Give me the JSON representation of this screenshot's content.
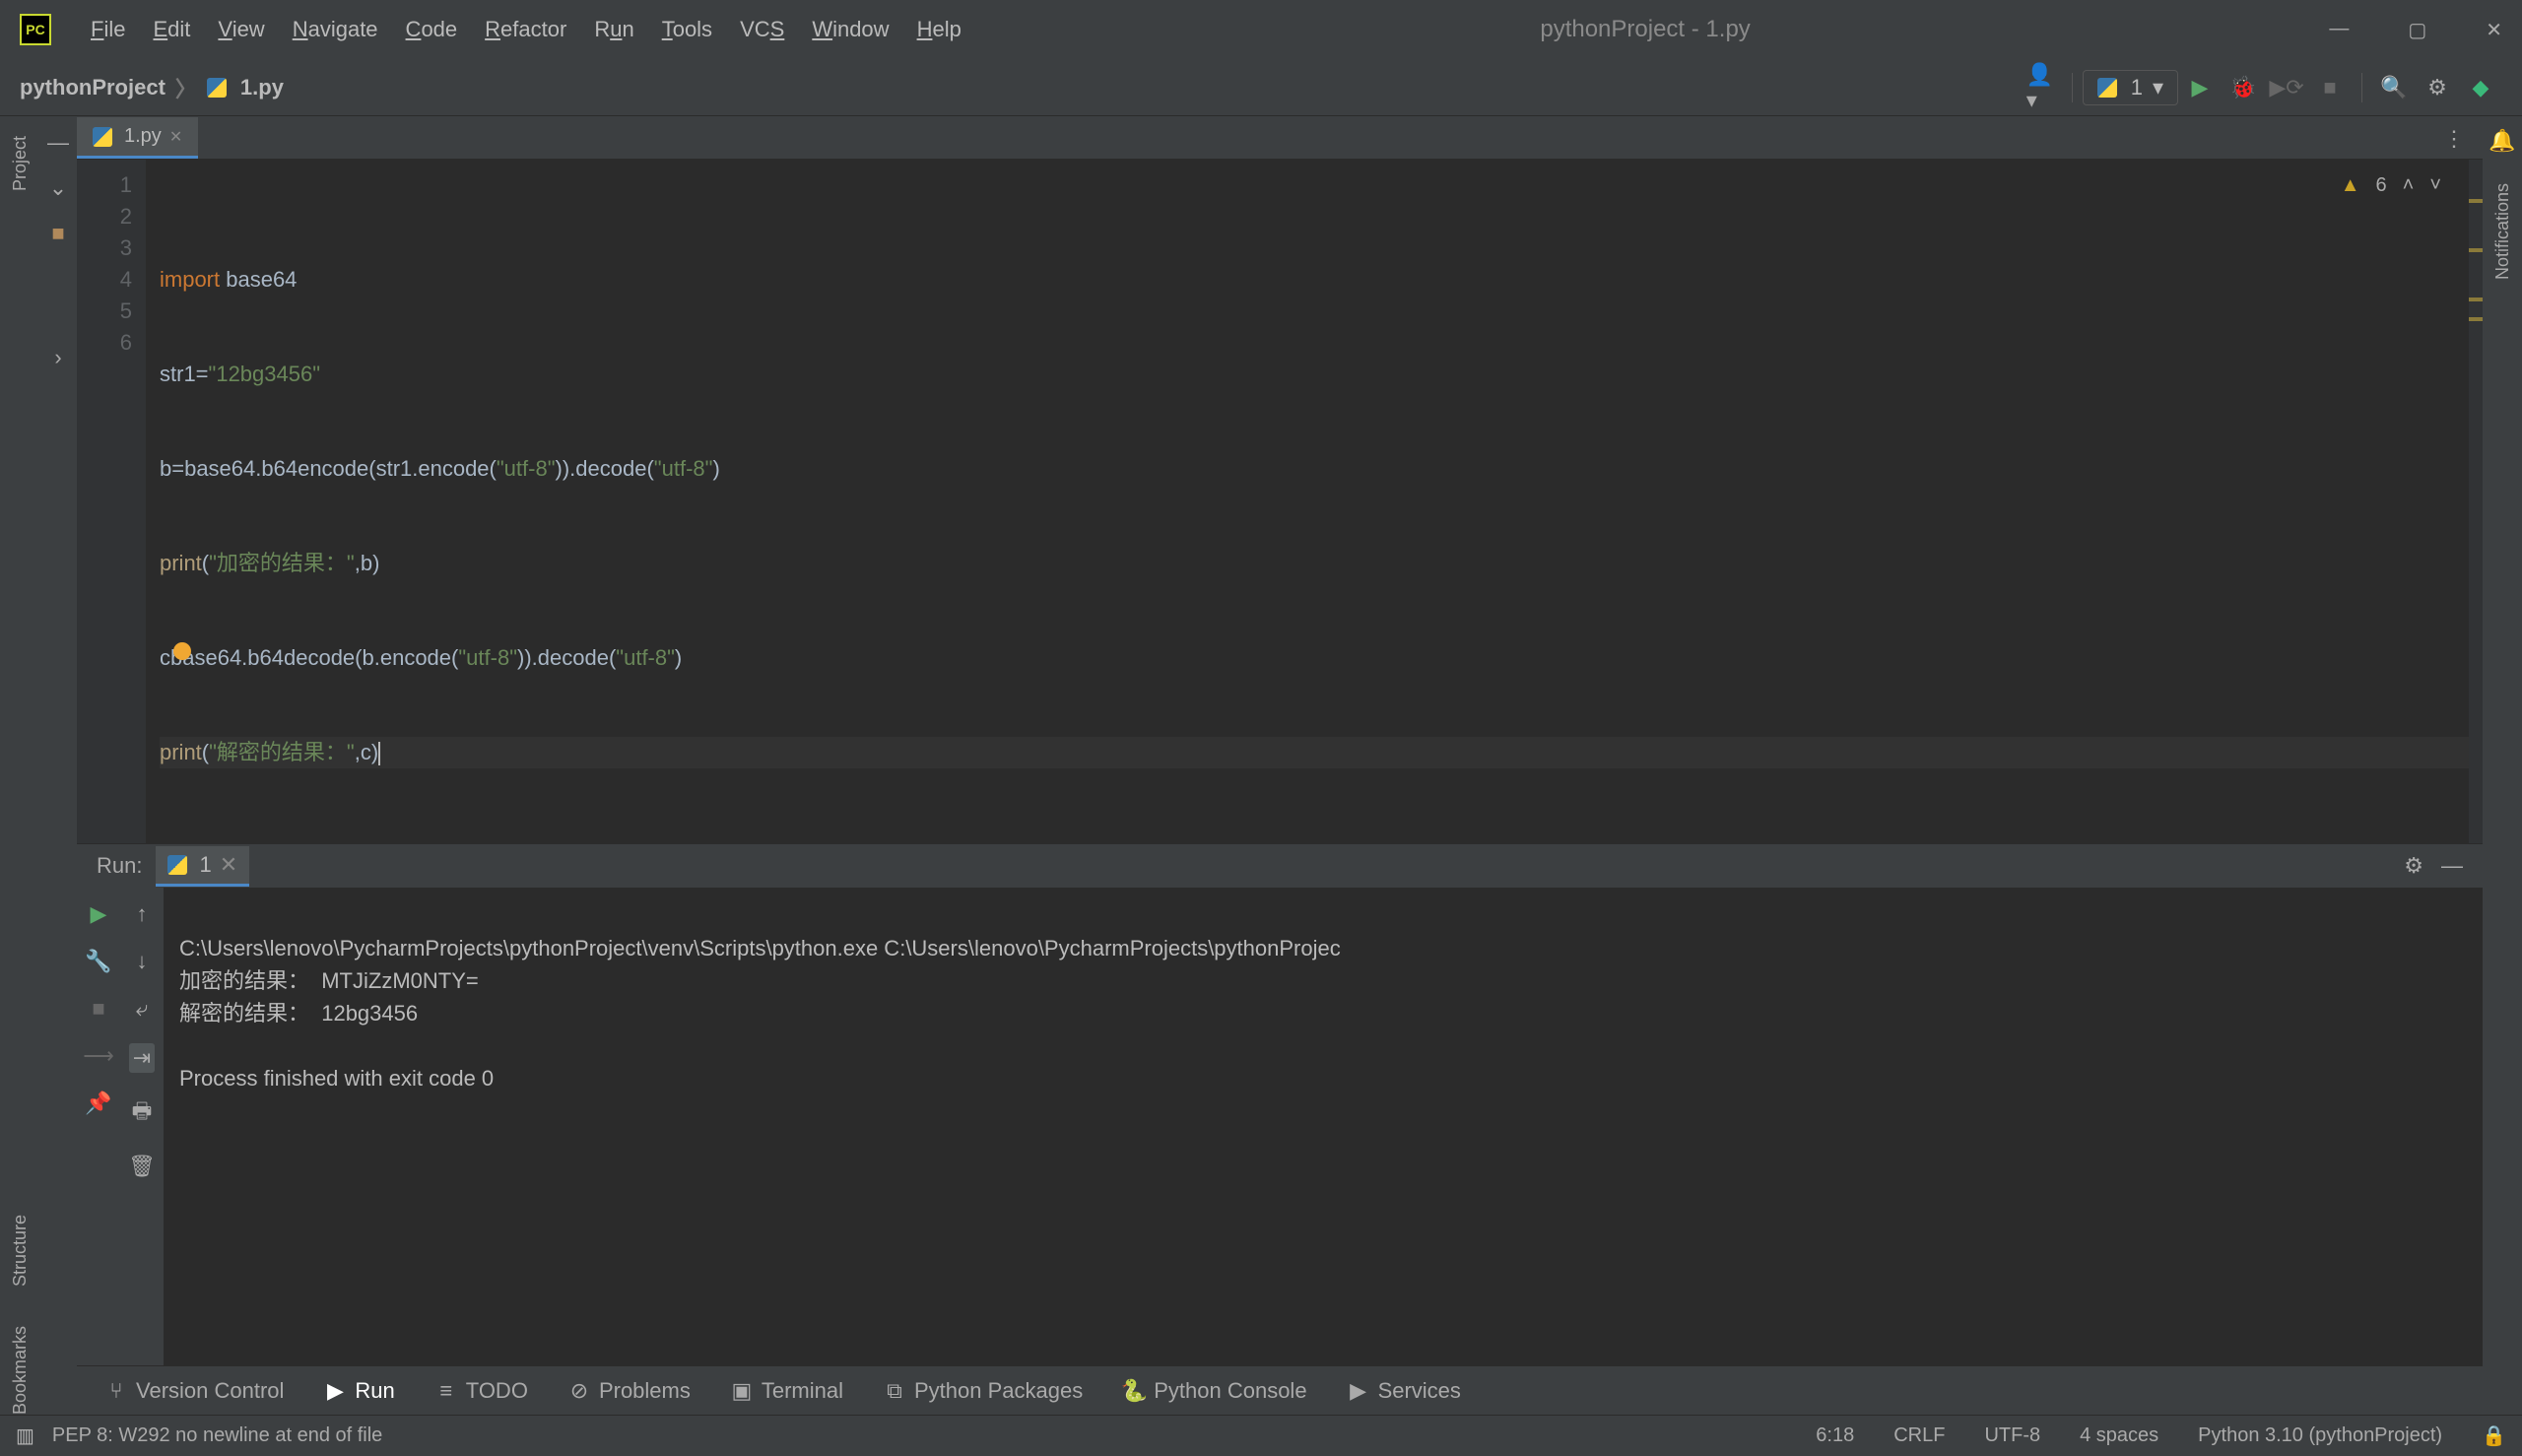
{
  "window": {
    "title": "pythonProject - 1.py"
  },
  "menu": {
    "file": "File",
    "edit": "Edit",
    "view": "View",
    "navigate": "Navigate",
    "code": "Code",
    "refactor": "Refactor",
    "run": "Run",
    "tools": "Tools",
    "vcs": "VCS",
    "window": "Window",
    "help": "Help"
  },
  "breadcrumb": {
    "project": "pythonProject",
    "file": "1.py"
  },
  "runConfig": {
    "name": "1"
  },
  "leftTools": {
    "project": "Project",
    "structure": "Structure",
    "bookmarks": "Bookmarks"
  },
  "rightTools": {
    "notifications": "Notifications"
  },
  "tab": {
    "name": "1.py"
  },
  "inspection": {
    "warnings": "6"
  },
  "code": {
    "lines": [
      "1",
      "2",
      "3",
      "4",
      "5",
      "6"
    ],
    "l1_kw": "import",
    "l1_id": " base64",
    "l2_a": "str1=",
    "l2_s": "\"12bg3456\"",
    "l3_a": "b=base64.b64encode(str1.encode(",
    "l3_s1": "\"utf-8\"",
    "l3_b": ")).decode(",
    "l3_s2": "\"utf-8\"",
    "l3_c": ")",
    "l4_fn": "print",
    "l4_a": "(",
    "l4_s": "\"加密的结果：\"",
    "l4_b": ",b)",
    "l5_a": "c=base64.b64decode(b.encode(",
    "l5_s1": "\"utf-8\"",
    "l5_b": ")).decode(",
    "l5_s2": "\"utf-8\"",
    "l5_c": ")",
    "l6_fn": "print",
    "l6_a": "(",
    "l6_s": "\"解密的结果：\"",
    "l6_b": ",c)"
  },
  "runTool": {
    "label": "Run:",
    "tab": "1",
    "out1": "C:\\Users\\lenovo\\PycharmProjects\\pythonProject\\venv\\Scripts\\python.exe C:\\Users\\lenovo\\PycharmProjects\\pythonProjec",
    "out2": "加密的结果：  MTJiZzM0NTY=",
    "out3": "解密的结果：  12bg3456",
    "out4": "",
    "out5": "Process finished with exit code 0"
  },
  "bottom": {
    "vcs": "Version Control",
    "run": "Run",
    "todo": "TODO",
    "problems": "Problems",
    "terminal": "Terminal",
    "pkgs": "Python Packages",
    "pyconsole": "Python Console",
    "services": "Services"
  },
  "status": {
    "msg": "PEP 8: W292 no newline at end of file",
    "pos": "6:18",
    "eol": "CRLF",
    "enc": "UTF-8",
    "indent": "4 spaces",
    "interp": "Python 3.10 (pythonProject)"
  }
}
